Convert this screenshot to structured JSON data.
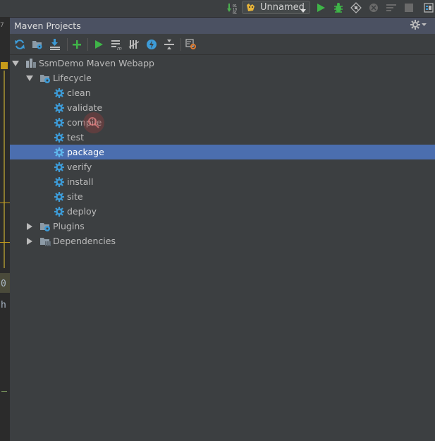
{
  "topbar": {
    "run_config_label": "Unnamed",
    "icons": [
      "vcs-update-icon",
      "run-config-icon",
      "run-icon",
      "debug-icon",
      "coverage-icon",
      "profile-icon",
      "build-icon",
      "stop-icon",
      "project-structure-icon"
    ]
  },
  "left_strip": {
    "line_number": "7",
    "fragment_1": "0",
    "fragment_2": "h"
  },
  "panel": {
    "title": "Maven Projects",
    "toolbar": [
      {
        "name": "reimport-icon"
      },
      {
        "name": "generate-sources-icon"
      },
      {
        "name": "download-sources-icon"
      },
      {
        "name": "add-maven-project-icon"
      },
      {
        "name": "run-maven-build-icon"
      },
      {
        "name": "execute-maven-goal-icon"
      },
      {
        "name": "toggle-offline-mode-icon"
      },
      {
        "name": "skip-tests-icon"
      },
      {
        "name": "collapse-all-icon"
      },
      {
        "name": "maven-settings-icon"
      }
    ]
  },
  "tree": {
    "project": "SsmDemo Maven Webapp",
    "lifecycle": "Lifecycle",
    "goals": [
      "clean",
      "validate",
      "compile",
      "test",
      "package",
      "verify",
      "install",
      "site",
      "deploy"
    ],
    "selected_goal": "package",
    "plugins": "Plugins",
    "dependencies": "Dependencies"
  },
  "colors": {
    "background": "#3c3f41",
    "header": "#4b5162",
    "selection": "#4b6eaf",
    "gear": "#3d9bd7",
    "run_green": "#3fb548"
  }
}
